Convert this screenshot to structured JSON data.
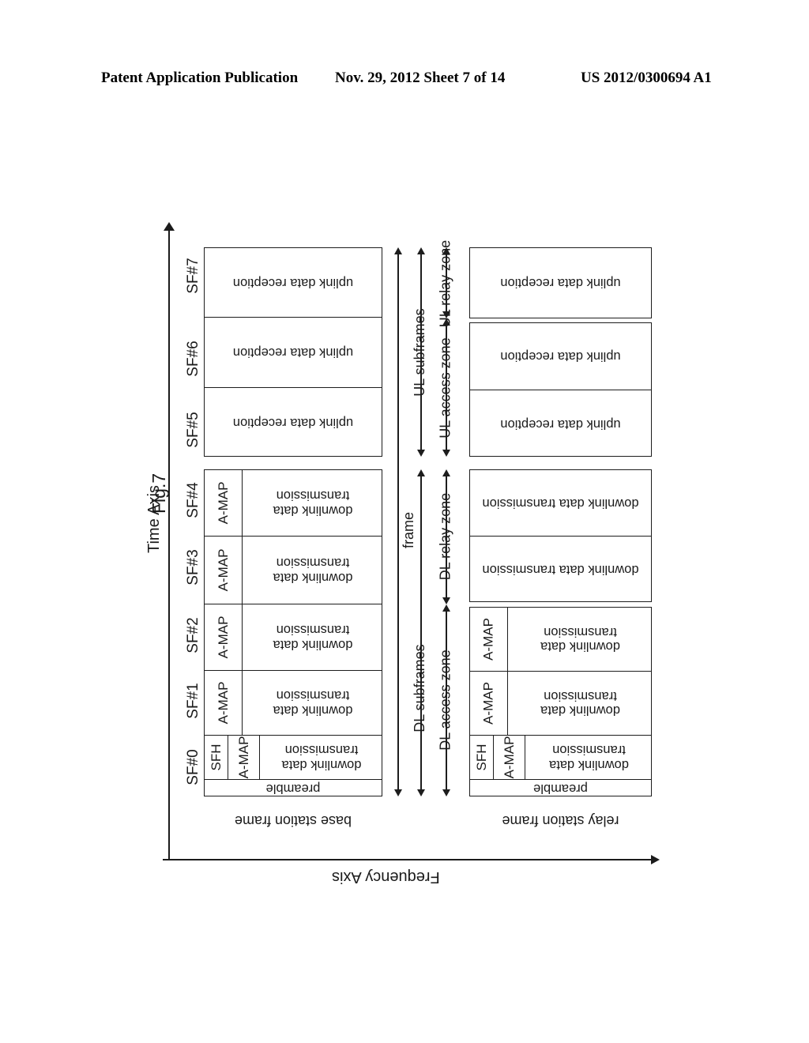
{
  "header": {
    "left": "Patent Application Publication",
    "middle": "Nov. 29, 2012  Sheet 7 of 14",
    "right": "US 2012/0300694 A1"
  },
  "figure": {
    "title": "Fig.7",
    "time_axis_label": "Time Axis",
    "frequency_axis_label": "Frequency Axis",
    "base_station_caption": "base station frame",
    "relay_station_caption": "relay station frame",
    "subframe_labels": [
      "SF#0",
      "SF#1",
      "SF#2",
      "SF#3",
      "SF#4",
      "SF#5",
      "SF#6",
      "SF#7"
    ],
    "zone_labels": {
      "frame": "frame",
      "dl_subframes": "DL subframes",
      "ul_subframes": "UL subframes",
      "dl_access_zone": "DL access zone",
      "dl_relay_zone": "DL relay zone",
      "ul_access_zone": "UL access zone",
      "ul_relay_zone": "UL relay zone"
    },
    "cells": {
      "preamble": "preamble",
      "sfh": "SFH",
      "amap": "A-MAP",
      "downlink_data": "downlink data transmission",
      "uplink_data": "uplink data reception"
    },
    "base_station_frame": {
      "dl_subframes": [
        {
          "index": "SF#0",
          "preamble": true,
          "sfh": true,
          "amap": true,
          "data": "downlink data transmission"
        },
        {
          "index": "SF#1",
          "preamble": false,
          "sfh": false,
          "amap": true,
          "data": "downlink data transmission"
        },
        {
          "index": "SF#2",
          "preamble": false,
          "sfh": false,
          "amap": true,
          "data": "downlink data transmission"
        },
        {
          "index": "SF#3",
          "preamble": false,
          "sfh": false,
          "amap": true,
          "data": "downlink data transmission"
        },
        {
          "index": "SF#4",
          "preamble": false,
          "sfh": false,
          "amap": true,
          "data": "downlink data transmission"
        }
      ],
      "ul_subframes": [
        {
          "index": "SF#5",
          "data": "uplink data reception"
        },
        {
          "index": "SF#6",
          "data": "uplink data reception"
        },
        {
          "index": "SF#7",
          "data": "uplink data reception"
        }
      ]
    },
    "relay_station_frame": {
      "dl_subframes": [
        {
          "index": "SF#0",
          "preamble": true,
          "sfh": true,
          "amap": true,
          "data": "downlink data transmission"
        },
        {
          "index": "SF#1",
          "preamble": false,
          "sfh": false,
          "amap": true,
          "data": "downlink data transmission"
        },
        {
          "index": "SF#2",
          "preamble": false,
          "sfh": false,
          "amap": true,
          "data": "downlink data transmission"
        },
        {
          "index": "SF#3",
          "preamble": false,
          "sfh": false,
          "amap": false,
          "data": "downlink data transmission"
        },
        {
          "index": "SF#4",
          "preamble": false,
          "sfh": false,
          "amap": false,
          "data": "downlink data transmission"
        }
      ],
      "ul_subframes": [
        {
          "index": "SF#5",
          "data": "uplink data reception"
        },
        {
          "index": "SF#6",
          "data": "uplink data reception"
        },
        {
          "index": "SF#7",
          "data": "uplink data reception"
        }
      ]
    }
  },
  "colors": {
    "ink": "#1b1b1b",
    "paper": "#ffffff"
  }
}
